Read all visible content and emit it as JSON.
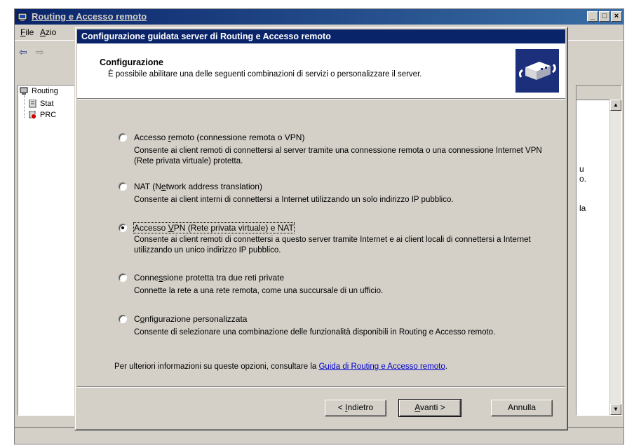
{
  "background_window": {
    "title": "Routing e Accesso remoto",
    "menu": [
      {
        "label": "File",
        "accel_index": 0
      },
      {
        "label": "Azio",
        "accel_index": 0
      }
    ],
    "tree": [
      {
        "label": "Routing",
        "icon": "server-computer-icon"
      },
      {
        "label": "Stat",
        "icon": "server-status-icon"
      },
      {
        "label": "PRC",
        "icon": "server-down-icon"
      }
    ],
    "right_fragments": [
      "u",
      "o.",
      "la"
    ]
  },
  "wizard": {
    "title": "Configurazione guidata server di Routing e Accesso remoto",
    "header_title": "Configurazione",
    "header_subtitle": "È possibile abilitare una delle seguenti combinazioni di servizi o personalizzare il server.",
    "header_icon": "routing-wizard-icon",
    "options": [
      {
        "label": "Accesso remoto (connessione remota o VPN)",
        "accel": "r",
        "description": "Consente ai client remoti di connettersi al server tramite una connessione remota o una connessione Internet VPN (Rete privata virtuale) protetta.",
        "selected": false
      },
      {
        "label": "NAT (Network address translation)",
        "accel": "e",
        "description": "Consente ai client interni di connettersi a Internet utilizzando un solo indirizzo IP pubblico.",
        "selected": false
      },
      {
        "label": "Accesso VPN (Rete privata virtuale) e NAT",
        "accel": "V",
        "description": "Consente ai client remoti di connettersi a questo server tramite Internet e ai client locali di connettersi a Internet utilizzando un unico indirizzo IP pubblico.",
        "selected": true
      },
      {
        "label": "Connessione protetta tra due reti private",
        "accel": "s",
        "description": "Connette la rete a una rete remota, come una succursale di un ufficio.",
        "selected": false
      },
      {
        "label": "Configurazione personalizzata",
        "accel": "o",
        "description": "Consente di selezionare una combinazione delle funzionalità disponibili in Routing e Accesso remoto.",
        "selected": false
      }
    ],
    "footer_text": "Per ulteriori informazioni su queste opzioni, consultare la ",
    "footer_link": "Guida di Routing e Accesso remoto",
    "footer_end": ".",
    "buttons": {
      "back": "< Indietro",
      "next": "Avanti >",
      "cancel": "Annulla"
    }
  },
  "colors": {
    "title_active": "#0a246a",
    "title_inactive_gradient": "#3a6ea5",
    "face": "#d4d0c8",
    "link": "#0000cc"
  }
}
